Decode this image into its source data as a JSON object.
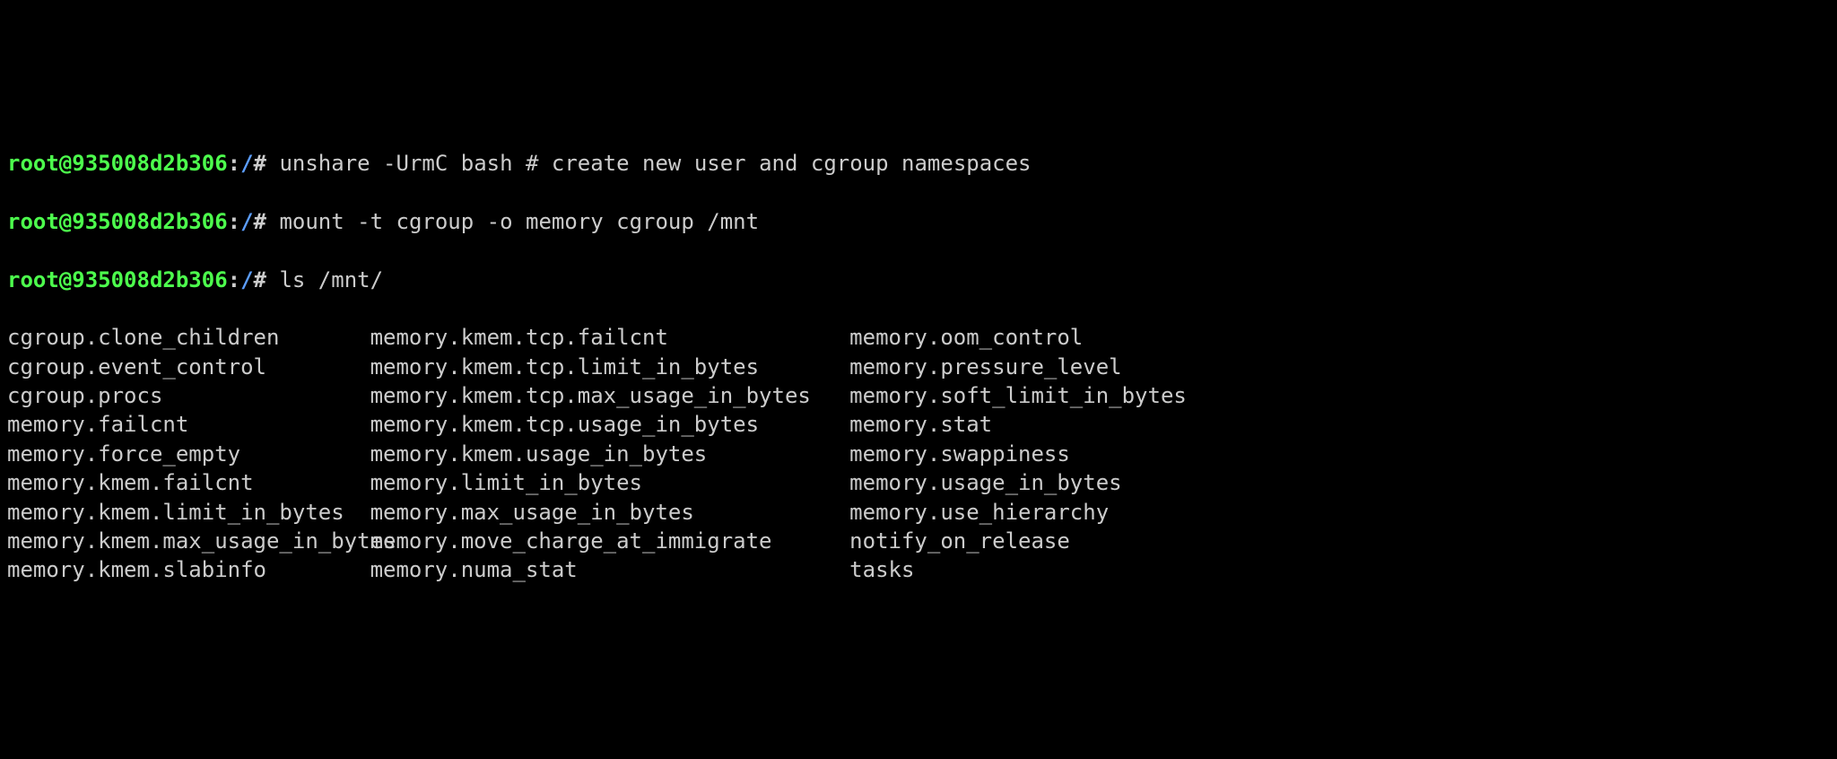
{
  "prompt": {
    "user_host": "root@935008d2b306",
    "colon": ":",
    "path": "/",
    "hash": "#"
  },
  "commands": [
    "unshare -UrmC bash # create new user and cgroup namespaces",
    "mount -t cgroup -o memory cgroup /mnt",
    "ls /mnt/"
  ],
  "ls_output": {
    "col1": [
      "cgroup.clone_children",
      "cgroup.event_control",
      "cgroup.procs",
      "memory.failcnt",
      "memory.force_empty",
      "memory.kmem.failcnt",
      "memory.kmem.limit_in_bytes",
      "memory.kmem.max_usage_in_bytes",
      "memory.kmem.slabinfo"
    ],
    "col2": [
      "memory.kmem.tcp.failcnt",
      "memory.kmem.tcp.limit_in_bytes",
      "memory.kmem.tcp.max_usage_in_bytes",
      "memory.kmem.tcp.usage_in_bytes",
      "memory.kmem.usage_in_bytes",
      "memory.limit_in_bytes",
      "memory.max_usage_in_bytes",
      "memory.move_charge_at_immigrate",
      "memory.numa_stat"
    ],
    "col3": [
      "memory.oom_control",
      "memory.pressure_level",
      "memory.soft_limit_in_bytes",
      "memory.stat",
      "memory.swappiness",
      "memory.usage_in_bytes",
      "memory.use_hierarchy",
      "notify_on_release",
      "tasks"
    ]
  }
}
